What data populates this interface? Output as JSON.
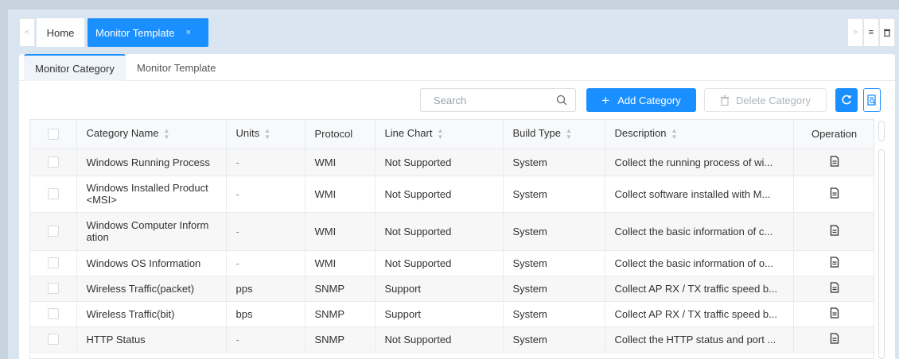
{
  "tabs": {
    "home": "Home",
    "active": "Monitor Template",
    "active_close": "×",
    "prev": "<",
    "next": ">",
    "menu": "≡"
  },
  "subtabs": [
    "Monitor Category",
    "Monitor Template"
  ],
  "toolbar": {
    "search_placeholder": "Search",
    "add_label": "Add Category",
    "delete_label": "Delete Category"
  },
  "table": {
    "columns": [
      "Category Name",
      "Units",
      "Protocol",
      "Line Chart",
      "Build Type",
      "Description",
      "Operation"
    ],
    "sortable": [
      true,
      true,
      false,
      true,
      true,
      true,
      false
    ],
    "rows": [
      {
        "name": "Windows Running Process",
        "units": "-",
        "protocol": "WMI",
        "line_chart": "Not Supported",
        "build_type": "System",
        "description": "Collect the running process of wi..."
      },
      {
        "name": "Windows Installed Product <MSI>",
        "units": "-",
        "protocol": "WMI",
        "line_chart": "Not Supported",
        "build_type": "System",
        "description": "Collect software installed with M..."
      },
      {
        "name": "Windows Computer Inform ation",
        "units": "-",
        "protocol": "WMI",
        "line_chart": "Not Supported",
        "build_type": "System",
        "description": "Collect the basic information of c..."
      },
      {
        "name": "Windows OS Information",
        "units": "-",
        "protocol": "WMI",
        "line_chart": "Not Supported",
        "build_type": "System",
        "description": "Collect the basic information of o..."
      },
      {
        "name": "Wireless Traffic(packet)",
        "units": "pps",
        "protocol": "SNMP",
        "line_chart": "Support",
        "build_type": "System",
        "description": "Collect AP RX / TX traffic speed b..."
      },
      {
        "name": "Wireless Traffic(bit)",
        "units": "bps",
        "protocol": "SNMP",
        "line_chart": "Support",
        "build_type": "System",
        "description": "Collect AP RX / TX traffic speed b..."
      },
      {
        "name": "HTTP Status",
        "units": "-",
        "protocol": "SNMP",
        "line_chart": "Not Supported",
        "build_type": "System",
        "description": "Collect the HTTP status and port ..."
      }
    ]
  },
  "colors": {
    "accent": "#1a8fff",
    "background": "#d9e6f2"
  },
  "icons": {
    "search": "search-icon",
    "refresh": "refresh-icon",
    "export": "export-icon",
    "delete": "trash-icon",
    "operation": "document-icon"
  }
}
